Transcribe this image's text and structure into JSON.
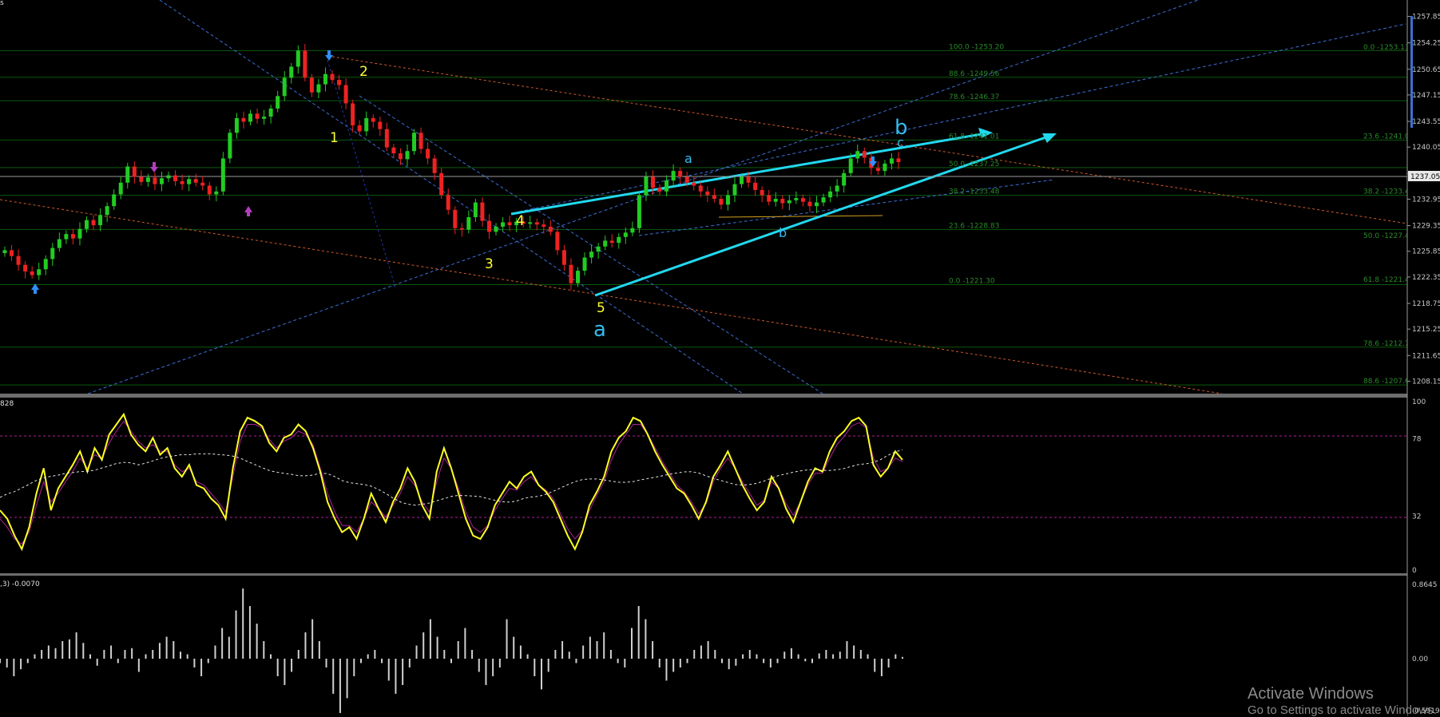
{
  "window": {
    "corner_char": "s"
  },
  "watermark": {
    "title": "Activate Windows",
    "subtitle": "Go to Settings to activate Windows."
  },
  "main_price_axis": {
    "ticks": [
      "1257.85",
      "1254.25",
      "1250.65",
      "1247.15",
      "1243.55",
      "1240.05",
      "1236.45",
      "1232.95",
      "1229.35",
      "1225.85",
      "1222.35",
      "1218.75",
      "1215.25",
      "1211.65",
      "1208.15"
    ],
    "current_price": "1237.05"
  },
  "fib_levels_left": [
    {
      "label": "100.0 -1253.20"
    },
    {
      "label": "88.6 -1249.56"
    },
    {
      "label": "78.6 -1246.37"
    },
    {
      "label": "61.8 -1241.01"
    },
    {
      "label": "50.0 -1237.25"
    },
    {
      "label": "38.2 -1233.48"
    },
    {
      "label": "23.6 -1228.83"
    },
    {
      "label": "0.0 -1221.30"
    }
  ],
  "fib_levels_right": [
    {
      "label": "0.0 -1253.13"
    },
    {
      "label": "23.6 -1241.01"
    },
    {
      "label": "38.2 -1233.48"
    },
    {
      "label": "50.0 -1227.46"
    },
    {
      "label": "61.8 -1221.45"
    },
    {
      "label": "78.6 -1212.79"
    },
    {
      "label": "88.6 -1207.64"
    }
  ],
  "wave_labels": {
    "w1": "1",
    "w2": "2",
    "w3": "3",
    "w4": "4",
    "w5": "5",
    "big_a": "a",
    "big_b": "b",
    "sub_a": "a",
    "sub_b": "b",
    "sub_c": "c"
  },
  "oscillator": {
    "label": "828",
    "levels": [
      "100",
      "78",
      "32",
      "0"
    ]
  },
  "histogram": {
    "label": ",3) -0.0070",
    "levels": [
      "0.8645",
      "0.00",
      "-0.5919"
    ]
  },
  "chart_data": [
    {
      "type": "candlestick",
      "title": "",
      "ylim": [
        1207.0,
        1259.0
      ],
      "x_index_range": [
        0,
        180
      ],
      "close_series": [
        1226.0,
        1225.2,
        1224.0,
        1223.1,
        1222.6,
        1223.4,
        1224.8,
        1226.3,
        1227.5,
        1228.2,
        1227.6,
        1228.9,
        1230.1,
        1229.4,
        1230.8,
        1232.0,
        1233.6,
        1235.2,
        1237.4,
        1236.0,
        1235.3,
        1235.9,
        1235.0,
        1235.8,
        1236.2,
        1235.4,
        1235.0,
        1235.7,
        1235.2,
        1234.8,
        1233.6,
        1234.0,
        1238.5,
        1242.0,
        1244.0,
        1243.5,
        1244.6,
        1243.9,
        1244.2,
        1245.3,
        1247.0,
        1249.5,
        1251.0,
        1253.2,
        1249.5,
        1247.5,
        1248.6,
        1250.0,
        1249.2,
        1248.5,
        1246.0,
        1243.0,
        1242.2,
        1244.0,
        1243.5,
        1242.5,
        1240.0,
        1239.2,
        1238.4,
        1239.5,
        1242.0,
        1239.8,
        1238.5,
        1236.5,
        1233.5,
        1231.5,
        1229.0,
        1228.8,
        1230.5,
        1232.5,
        1230.0,
        1228.5,
        1229.2,
        1229.8,
        1229.4,
        1229.9,
        1229.6,
        1229.8,
        1229.5,
        1229.2,
        1228.5,
        1226.0,
        1224.0,
        1221.5,
        1223.2,
        1225.0,
        1225.8,
        1226.5,
        1227.3,
        1227.0,
        1227.8,
        1228.4,
        1229.0,
        1233.5,
        1236.0,
        1234.5,
        1234.0,
        1235.5,
        1236.8,
        1236.0,
        1235.2,
        1234.8,
        1234.0,
        1233.5,
        1233.0,
        1232.2,
        1233.5,
        1235.0,
        1236.0,
        1235.2,
        1234.2,
        1233.5,
        1232.6,
        1233.0,
        1232.4,
        1232.8,
        1233.1,
        1232.6,
        1232.0,
        1232.5,
        1233.2,
        1234.0,
        1234.8,
        1236.5,
        1238.5,
        1239.5,
        1238.6,
        1237.2,
        1236.8,
        1237.8,
        1238.5,
        1238.0
      ],
      "fib_grid_values": [
        1253.2,
        1249.56,
        1246.37,
        1241.01,
        1237.25,
        1233.48,
        1228.83,
        1221.3,
        1212.79,
        1207.64
      ]
    },
    {
      "type": "line",
      "title": "",
      "ylim": [
        0,
        100
      ],
      "levels": [
        32,
        78
      ],
      "series": [
        {
          "values": [
            35,
            30,
            20,
            12,
            25,
            45,
            60,
            35,
            48,
            55,
            62,
            70,
            58,
            72,
            65,
            80,
            86,
            92,
            80,
            74,
            70,
            78,
            68,
            72,
            60,
            55,
            62,
            50,
            48,
            42,
            38,
            30,
            60,
            82,
            90,
            88,
            85,
            75,
            70,
            78,
            80,
            86,
            82,
            72,
            58,
            40,
            30,
            22,
            25,
            18,
            30,
            45,
            36,
            28,
            40,
            48,
            60,
            52,
            38,
            30,
            58,
            72,
            60,
            45,
            30,
            20,
            18,
            25,
            38,
            45,
            52,
            48,
            55,
            58,
            50,
            46,
            40,
            30,
            20,
            12,
            22,
            38,
            46,
            55,
            70,
            78,
            82,
            90,
            88,
            80,
            70,
            62,
            55,
            48,
            45,
            38,
            30,
            40,
            55,
            62,
            70,
            60,
            50,
            42,
            35,
            40,
            55,
            48,
            36,
            28,
            40,
            52,
            60,
            58,
            70,
            78,
            82,
            88,
            90,
            85,
            62,
            55,
            60,
            70,
            65
          ]
        },
        {
          "values": [
            30,
            25,
            18,
            15,
            22,
            38,
            52,
            40,
            45,
            52,
            58,
            66,
            60,
            68,
            66,
            75,
            82,
            88,
            82,
            76,
            72,
            74,
            70,
            70,
            62,
            58,
            60,
            52,
            50,
            45,
            40,
            34,
            55,
            76,
            86,
            86,
            84,
            77,
            72,
            76,
            78,
            82,
            80,
            74,
            60,
            45,
            34,
            26,
            26,
            22,
            30,
            40,
            36,
            31,
            38,
            45,
            55,
            50,
            40,
            34,
            52,
            66,
            60,
            48,
            34,
            25,
            22,
            26,
            35,
            42,
            48,
            47,
            52,
            55,
            50,
            47,
            42,
            33,
            24,
            18,
            23,
            35,
            44,
            52,
            65,
            74,
            80,
            86,
            86,
            80,
            72,
            64,
            57,
            50,
            46,
            40,
            33,
            39,
            52,
            60,
            66,
            60,
            52,
            45,
            38,
            41,
            52,
            48,
            39,
            32,
            40,
            50,
            57,
            57,
            66,
            74,
            79,
            85,
            87,
            84,
            66,
            58,
            60,
            66,
            64
          ]
        }
      ]
    },
    {
      "type": "bar",
      "title": "",
      "ylim": [
        -0.5919,
        0.8645
      ],
      "values": [
        -0.05,
        -0.1,
        -0.2,
        -0.12,
        -0.05,
        0.05,
        0.1,
        0.15,
        0.12,
        0.2,
        0.22,
        0.3,
        0.18,
        0.05,
        -0.08,
        0.1,
        0.15,
        -0.05,
        0.1,
        0.12,
        -0.15,
        0.05,
        0.1,
        0.18,
        0.25,
        0.2,
        0.08,
        0.05,
        -0.1,
        -0.2,
        -0.05,
        0.15,
        0.35,
        0.25,
        0.55,
        0.8,
        0.6,
        0.4,
        0.2,
        0.05,
        -0.2,
        -0.3,
        -0.15,
        0.1,
        0.3,
        0.45,
        0.2,
        -0.1,
        -0.4,
        -0.65,
        -0.45,
        -0.2,
        -0.05,
        0.05,
        0.1,
        -0.05,
        -0.25,
        -0.4,
        -0.3,
        -0.1,
        0.15,
        0.3,
        0.45,
        0.25,
        0.1,
        -0.05,
        0.2,
        0.35,
        0.1,
        -0.15,
        -0.3,
        -0.2,
        -0.1,
        0.45,
        0.25,
        0.15,
        0.05,
        -0.2,
        -0.35,
        -0.15,
        0.1,
        0.2,
        0.08,
        -0.05,
        0.15,
        0.25,
        0.2,
        0.3,
        0.1,
        -0.05,
        -0.1,
        0.35,
        0.6,
        0.45,
        0.2,
        -0.1,
        -0.25,
        -0.15,
        -0.1,
        -0.05,
        0.1,
        0.15,
        0.2,
        0.1,
        -0.05,
        -0.12,
        -0.08,
        0.05,
        0.1,
        0.05,
        -0.05,
        -0.1,
        -0.05,
        0.08,
        0.12,
        0.05,
        -0.03,
        -0.05,
        0.06,
        0.1,
        0.05,
        0.08,
        0.2,
        0.15,
        0.1,
        0.05,
        -0.15,
        -0.2,
        -0.1,
        0.05,
        0.02
      ]
    }
  ]
}
